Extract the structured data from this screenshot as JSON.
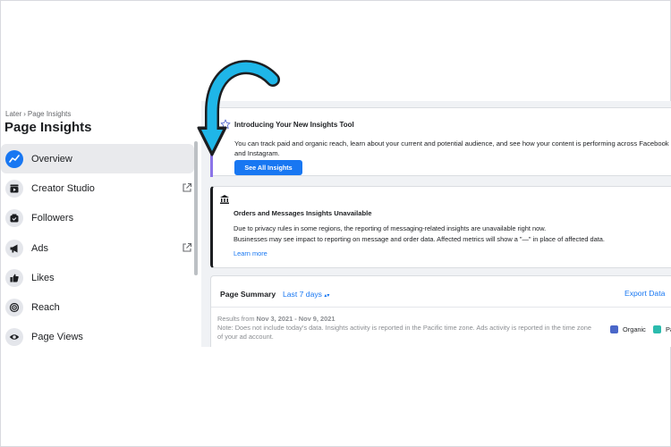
{
  "breadcrumb": {
    "parent": "Later",
    "separator": "›",
    "current": "Page Insights"
  },
  "page_title": "Page Insights",
  "sidebar": {
    "items": [
      {
        "label": "Overview",
        "icon": "trend-icon",
        "active": true,
        "external": false
      },
      {
        "label": "Creator Studio",
        "icon": "clapper-icon",
        "active": false,
        "external": true
      },
      {
        "label": "Followers",
        "icon": "followers-icon",
        "active": false,
        "external": false
      },
      {
        "label": "Ads",
        "icon": "megaphone-icon",
        "active": false,
        "external": true
      },
      {
        "label": "Likes",
        "icon": "thumbs-up-icon",
        "active": false,
        "external": false
      },
      {
        "label": "Reach",
        "icon": "reach-icon",
        "active": false,
        "external": false
      },
      {
        "label": "Page Views",
        "icon": "eye-icon",
        "active": false,
        "external": false
      }
    ]
  },
  "intro_card": {
    "title": "Introducing Your New Insights Tool",
    "description": "You can track paid and organic reach, learn about your current and potential audience, and see how your content is performing across Facebook and Instagram.",
    "button": "See All Insights"
  },
  "orders_card": {
    "title": "Orders and Messages Insights Unavailable",
    "line1": "Due to privacy rules in some regions, the reporting of messaging-related insights are unavailable right now.",
    "line2": "Businesses may see impact to reporting on message and order data. Affected metrics will show a \"—\" in place of affected data.",
    "link": "Learn more"
  },
  "summary_card": {
    "title": "Page Summary",
    "range": "Last 7 days",
    "export": "Export Data",
    "results_prefix": "Results from",
    "results_range": "Nov 3, 2021 - Nov 9, 2021",
    "note": "Note: Does not include today's data. Insights activity is reported in the Pacific time zone. Ads activity is reported in the time zone of your ad account.",
    "legend": [
      {
        "label": "Organic",
        "color": "#4a67c9"
      },
      {
        "label": "Pa",
        "color": "#2bbbad"
      }
    ]
  },
  "colors": {
    "accent": "#1877f2",
    "arrow": "#1fb6e8"
  }
}
